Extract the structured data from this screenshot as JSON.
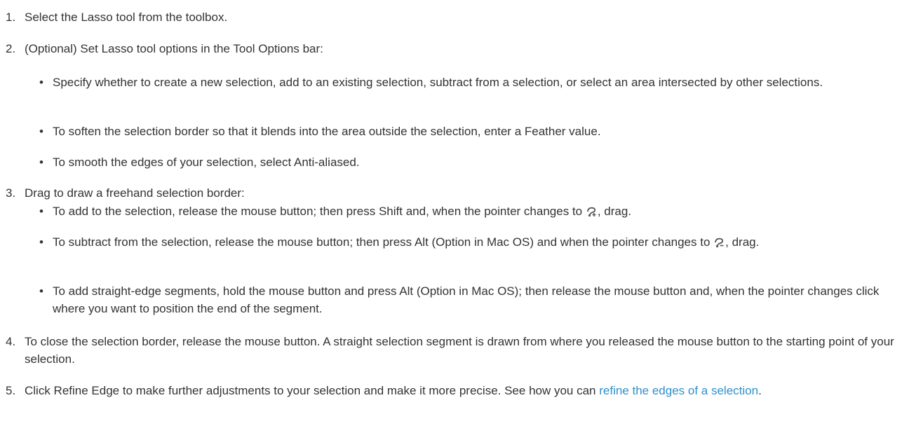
{
  "steps": [
    {
      "num": "1.",
      "text": "Select the Lasso tool from the toolbox."
    },
    {
      "num": "2.",
      "text": "(Optional) Set Lasso tool options in the Tool Options bar:"
    },
    {
      "num": "3.",
      "text": "Drag to draw a freehand selection border:"
    },
    {
      "num": "4.",
      "text": "To close the selection border, release the mouse button. A straight selection segment is drawn from where you released the mouse button to the starting point of your selection."
    },
    {
      "num": "5.",
      "text_before": "Click Refine Edge to make further adjustments to your selection and make it more precise. See how you can ",
      "link": "refine the edges of a selection",
      "text_after": "."
    }
  ],
  "step2_bullets": [
    "Specify whether to create a new selection, add to an existing selection, subtract from a selection, or select an area intersected by other selections.",
    "To soften the selection border so that it blends into the area outside the selection, enter a Feather value.",
    "To smooth the edges of your selection, select Anti-aliased."
  ],
  "step3_bullets": [
    {
      "before": "To add to the selection, release the mouse button; then press Shift and, when the pointer changes to ",
      "icon": "lasso-add-icon",
      "after": ", drag."
    },
    {
      "before": "To subtract from the selection, release the mouse button; then press Alt (Option in Mac OS) and when the pointer changes to ",
      "icon": "lasso-subtract-icon",
      "after": ", drag."
    },
    {
      "text": "To add straight-edge segments, hold the mouse button and press Alt (Option in Mac OS); then release the mouse button and, when the pointer changes click where you want to position the end of the segment."
    }
  ],
  "bullet_char": "•",
  "colors": {
    "text": "#333333",
    "link": "#2f8fc9"
  }
}
